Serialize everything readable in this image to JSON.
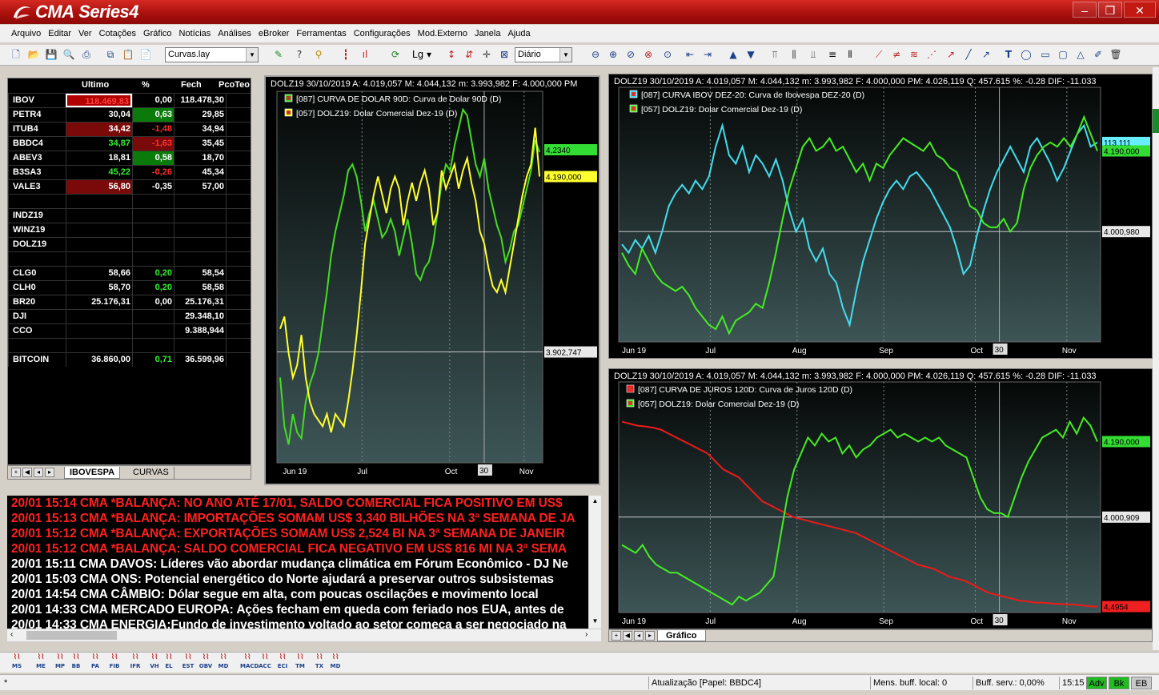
{
  "title_bar": {
    "logo": "CMA",
    "logo_series": "Series4",
    "minimize": "–",
    "restore": "❐",
    "close": "✕"
  },
  "menu": [
    "Arquivo",
    "Editar",
    "Ver",
    "Cotações",
    "Gráfico",
    "Notícias",
    "Análises",
    "eBroker",
    "Ferramentas",
    "Configurações",
    "Mod.Externo",
    "Janela",
    "Ajuda"
  ],
  "toolbar": {
    "layout_select": "Curvas.lay",
    "scale_select": "Lg",
    "period_select": "Diário"
  },
  "quotes": {
    "headers": [
      "Ultimo",
      "%",
      "Fech",
      "PcoTeo"
    ],
    "rows": [
      {
        "sym": "IBOV",
        "last": "118.469,83",
        "pct": "0,00",
        "close": "118.478,30",
        "last_bg": "#b00000",
        "pct_bg": "",
        "last_color": "#ff4040",
        "pct_color": "#ffffff"
      },
      {
        "sym": "PETR4",
        "last": "30,04",
        "pct": "0,63",
        "close": "29,85",
        "last_bg": "",
        "pct_bg": "#0a7a0a",
        "last_color": "#ffffff",
        "pct_color": "#ffffff"
      },
      {
        "sym": "ITUB4",
        "last": "34,42",
        "pct": "-1,48",
        "close": "34,94",
        "last_bg": "#7a0a0a",
        "pct_bg": "",
        "last_color": "#ffffff",
        "pct_color": "#ff3030"
      },
      {
        "sym": "BBDC4",
        "last": "34,87",
        "pct": "-1,63",
        "close": "35,45",
        "last_bg": "",
        "pct_bg": "#7a0a0a",
        "last_color": "#33ee33",
        "pct_color": "#ff3030"
      },
      {
        "sym": "ABEV3",
        "last": "18,81",
        "pct": "0,58",
        "close": "18,70",
        "last_bg": "",
        "pct_bg": "#0a7a0a",
        "last_color": "#ffffff",
        "pct_color": "#ffffff"
      },
      {
        "sym": "B3SA3",
        "last": "45,22",
        "pct": "-0,26",
        "close": "45,34",
        "last_bg": "",
        "pct_bg": "",
        "last_color": "#33ee33",
        "pct_color": "#ff3030"
      },
      {
        "sym": "VALE3",
        "last": "56,80",
        "pct": "-0,35",
        "close": "57,00",
        "last_bg": "#7a0a0a",
        "pct_bg": "",
        "last_color": "#ffffff",
        "pct_color": "#ffffff"
      },
      {
        "sym": "",
        "last": "",
        "pct": "",
        "close": "",
        "last_bg": "",
        "pct_bg": "",
        "last_color": "#ffffff",
        "pct_color": "#ffffff"
      },
      {
        "sym": "INDZ19",
        "last": "",
        "pct": "",
        "close": "",
        "last_bg": "",
        "pct_bg": "",
        "last_color": "#ffffff",
        "pct_color": "#ffffff"
      },
      {
        "sym": "WINZ19",
        "last": "",
        "pct": "",
        "close": "",
        "last_bg": "",
        "pct_bg": "",
        "last_color": "#ffffff",
        "pct_color": "#ffffff"
      },
      {
        "sym": "DOLZ19",
        "last": "",
        "pct": "",
        "close": "",
        "last_bg": "",
        "pct_bg": "",
        "last_color": "#ffffff",
        "pct_color": "#ffffff"
      },
      {
        "sym": "",
        "last": "",
        "pct": "",
        "close": "",
        "last_bg": "",
        "pct_bg": "",
        "last_color": "#ffffff",
        "pct_color": "#ffffff"
      },
      {
        "sym": "CLG0",
        "last": "58,66",
        "pct": "0,20",
        "close": "58,54",
        "last_bg": "",
        "pct_bg": "",
        "last_color": "#ffffff",
        "pct_color": "#33ee33"
      },
      {
        "sym": "CLH0",
        "last": "58,70",
        "pct": "0,20",
        "close": "58,58",
        "last_bg": "",
        "pct_bg": "",
        "last_color": "#ffffff",
        "pct_color": "#33ee33"
      },
      {
        "sym": "BR20",
        "last": "25.176,31",
        "pct": "0,00",
        "close": "25.176,31",
        "last_bg": "",
        "pct_bg": "",
        "last_color": "#ffffff",
        "pct_color": "#ffffff"
      },
      {
        "sym": "DJI",
        "last": "",
        "pct": "",
        "close": "29.348,10",
        "last_bg": "",
        "pct_bg": "",
        "last_color": "#ffffff",
        "pct_color": "#ffffff"
      },
      {
        "sym": "CCO",
        "last": "",
        "pct": "",
        "close": "9.388,944",
        "last_bg": "",
        "pct_bg": "",
        "last_color": "#ffffff",
        "pct_color": "#ffffff"
      },
      {
        "sym": "",
        "last": "",
        "pct": "",
        "close": "",
        "last_bg": "",
        "pct_bg": "",
        "last_color": "#ffffff",
        "pct_color": "#ffffff"
      },
      {
        "sym": "BITCOIN",
        "last": "36.860,00",
        "pct": "0,71",
        "close": "36.599,96",
        "last_bg": "",
        "pct_bg": "",
        "last_color": "#ffffff",
        "pct_color": "#33ee33"
      }
    ],
    "tabs": [
      "IBOVESPA",
      "CURVAS"
    ]
  },
  "news": [
    {
      "text": "20/01 15:14 CMA *BALANÇA: NO ANO ATÉ 17/01, SALDO COMERCIAL FICA POSITIVO EM US$",
      "color": "#ff2020"
    },
    {
      "text": "20/01 15:13 CMA *BALANÇA: IMPORTAÇÕES SOMAM US$ 3,340 BILHÕES NA 3ª SEMANA DE JA",
      "color": "#ff2020"
    },
    {
      "text": "20/01 15:12 CMA *BALANÇA: EXPORTAÇÕES SOMAM US$ 2,524 BI NA 3ª SEMANA DE JANEIR",
      "color": "#ff2020"
    },
    {
      "text": "20/01 15:12 CMA *BALANÇA: SALDO COMERCIAL FICA NEGATIVO EM US$ 816 MI NA 3ª SEMA",
      "color": "#ff2020"
    },
    {
      "text": "20/01 15:11 CMA DAVOS: Líderes vão abordar mudança climática em Fórum Econômico - DJ Ne",
      "color": "#ffffff"
    },
    {
      "text": "20/01 15:03 CMA ONS: Potencial energético do Norte ajudará a preservar outros subsistemas",
      "color": "#ffffff"
    },
    {
      "text": "20/01 14:54 CMA CÂMBIO: Dólar segue em alta, com poucas oscilações e movimento local",
      "color": "#ffffff"
    },
    {
      "text": "20/01 14:33 CMA MERCADO EUROPA: Ações fecham em queda com feriado nos EUA, antes de",
      "color": "#ffffff"
    },
    {
      "text": "20/01 14:33 CMA ENERGIA:Fundo de investimento voltado ao setor começa a ser negociado na",
      "color": "#ffffff"
    }
  ],
  "chart_data": [
    {
      "type": "line",
      "header": "DOLZ19   30/10/2019   A: 4.019,057    M: 4.044,132    m: 3.993,982    F: 4.000,000   PM",
      "x_labels": [
        "Jun 19",
        "Jul",
        "Oct",
        "30",
        "Nov"
      ],
      "yticks": [
        "4.300,000",
        "4.250,000",
        "4.200,000",
        "4.150,000",
        "4.100,000",
        "4.050,000",
        "4.000,000",
        "3.950,000",
        "3.900,000",
        "3.850,000",
        "3.800,000",
        "3.750,000"
      ],
      "ylim": [
        3.72,
        4.33
      ],
      "last_labels": [
        {
          "text": "4,2340",
          "value": 4.234,
          "color": "#33dd33"
        },
        {
          "text": "4.190,000",
          "value": 4.19,
          "color": "#ffff30"
        },
        {
          "text": "3.902,747",
          "value": 3.902,
          "color": "#ffffff"
        }
      ],
      "series": [
        {
          "name": "[087] CURVA DE DOLAR 90D: Curva de Dolar  90D",
          "tag": "(D)",
          "color": "#44dd22",
          "values": [
            3.86,
            3.78,
            3.75,
            3.8,
            3.77,
            3.76,
            3.82,
            3.85,
            3.87,
            3.9,
            3.95,
            4.0,
            4.06,
            4.1,
            4.13,
            4.16,
            4.2,
            4.21,
            4.19,
            4.15,
            4.1,
            4.13,
            4.15,
            4.12,
            4.09,
            4.1,
            4.12,
            4.1,
            4.06,
            4.09,
            4.12,
            4.08,
            4.03,
            4.02,
            4.04,
            4.05,
            4.08,
            4.13,
            4.18,
            4.21,
            4.2,
            4.24,
            4.27,
            4.3,
            4.29,
            4.25,
            4.21,
            4.19,
            4.22,
            4.17,
            4.14,
            4.11,
            4.09,
            4.05,
            4.07,
            4.1,
            4.11,
            4.14,
            4.17,
            4.2,
            4.25,
            4.23
          ]
        },
        {
          "name": "[057] DOLZ19: Dolar Comercial Dez-19",
          "tag": "(D)",
          "color": "#ffff30",
          "values": [
            3.94,
            3.96,
            3.9,
            3.86,
            3.88,
            3.93,
            3.86,
            3.82,
            3.8,
            3.79,
            3.78,
            3.8,
            3.77,
            3.8,
            3.79,
            3.78,
            3.82,
            3.87,
            3.93,
            4.0,
            4.08,
            4.12,
            4.16,
            4.19,
            4.16,
            4.13,
            4.17,
            4.19,
            4.17,
            4.11,
            4.15,
            4.18,
            4.15,
            4.18,
            4.2,
            4.17,
            4.11,
            4.13,
            4.2,
            4.17,
            4.19,
            4.21,
            4.17,
            4.2,
            4.22,
            4.18,
            4.15,
            4.1,
            4.08,
            4.04,
            4.01,
            4.0,
            4.02,
            4.0,
            4.04,
            4.08,
            4.12,
            4.16,
            4.19,
            4.21,
            4.27,
            4.19
          ]
        }
      ]
    },
    {
      "type": "line",
      "header": "DOLZ19   30/10/2019   A: 4.019,057    M: 4.044,132    m: 3.993,982    F: 4.000,000   PM: 4.026,119   Q: 457.615   %: -0.28  DIF: -11.033",
      "x_labels": [
        "Jun 19",
        "Jul",
        "Aug",
        "Sep",
        "Oct",
        "30",
        "Nov"
      ],
      "yticks": [
        "4.300,000",
        "4.200,000",
        "4.100,000",
        "4.000,000",
        "3.900,000",
        "3.800,000"
      ],
      "ylim": [
        3.74,
        4.34
      ],
      "last_labels": [
        {
          "text": "113.111",
          "value": 4.21,
          "color": "#66eeff"
        },
        {
          "text": "4.190,000",
          "value": 4.19,
          "color": "#33dd33"
        },
        {
          "text": "4.000,980",
          "value": 4.0,
          "color": "#ffffff"
        }
      ],
      "series": [
        {
          "name": "[087] CURVA IBOV DEZ-20: Curva de Ibovespa  DEZ-20",
          "tag": "(D)",
          "color": "#44ddee",
          "values": [
            3.97,
            3.95,
            3.98,
            3.96,
            3.99,
            3.95,
            4.0,
            4.06,
            4.09,
            4.11,
            4.09,
            4.12,
            4.1,
            4.13,
            4.2,
            4.25,
            4.18,
            4.16,
            4.2,
            4.14,
            4.18,
            4.16,
            4.13,
            4.17,
            4.12,
            4.05,
            4.0,
            4.03,
            3.96,
            3.93,
            3.96,
            3.9,
            3.88,
            3.82,
            3.78,
            3.86,
            3.93,
            3.98,
            4.03,
            4.07,
            4.1,
            4.12,
            4.1,
            4.13,
            4.14,
            4.12,
            4.1,
            4.07,
            4.04,
            4.01,
            3.96,
            3.9,
            3.92,
            3.99,
            4.05,
            4.1,
            4.14,
            4.17,
            4.2,
            4.17,
            4.14,
            4.2,
            4.22,
            4.19,
            4.16,
            4.12,
            4.15,
            4.19,
            4.23,
            4.25,
            4.2,
            4.21
          ]
        },
        {
          "name": "[057] DOLZ19: Dolar Comercial Dez-19",
          "tag": "(D)",
          "color": "#44ee22",
          "values": [
            3.95,
            3.92,
            3.9,
            3.96,
            3.93,
            3.9,
            3.88,
            3.87,
            3.86,
            3.87,
            3.85,
            3.82,
            3.8,
            3.78,
            3.77,
            3.8,
            3.76,
            3.79,
            3.8,
            3.81,
            3.83,
            3.82,
            3.88,
            3.95,
            4.03,
            4.1,
            4.15,
            4.2,
            4.22,
            4.19,
            4.2,
            4.22,
            4.19,
            4.2,
            4.17,
            4.14,
            4.16,
            4.12,
            4.16,
            4.15,
            4.18,
            4.2,
            4.22,
            4.21,
            4.2,
            4.19,
            4.21,
            4.18,
            4.17,
            4.15,
            4.14,
            4.1,
            4.06,
            4.05,
            4.02,
            4.01,
            4.01,
            4.03,
            4.0,
            4.02,
            4.1,
            4.15,
            4.18,
            4.2,
            4.21,
            4.2,
            4.22,
            4.2,
            4.23,
            4.27,
            4.23,
            4.19
          ]
        }
      ]
    },
    {
      "type": "line",
      "header": "DOLZ19   30/10/2019   A: 4.019,057    M: 4.044,132    m: 3.993,982    F: 4.000,000   PM: 4.026,119   Q: 457.615   %: -0.28  DIF: -11.033",
      "x_labels": [
        "Jun 19",
        "Jul",
        "Aug",
        "Sep",
        "Oct",
        "30",
        "Nov"
      ],
      "yticks": [
        "4.300,000",
        "4.200,000",
        "4.100,000",
        "4.000,000",
        "3.900,000",
        "3.800,000"
      ],
      "ylim": [
        3.76,
        4.34
      ],
      "last_labels": [
        {
          "text": "4.190,000",
          "value": 4.19,
          "color": "#33dd33"
        },
        {
          "text": "4.000,909",
          "value": 4.0,
          "color": "#ffffff"
        },
        {
          "text": "4,4954",
          "value": 3.775,
          "color": "#ee2020"
        }
      ],
      "series": [
        {
          "name": "[087] CURVA DE JUROS 120D: Curva de Juros  120D",
          "tag": "(D)",
          "color": "#ee1a1a",
          "values": [
            4.24,
            4.235,
            4.23,
            4.228,
            4.225,
            4.22,
            4.21,
            4.2,
            4.19,
            4.18,
            4.17,
            4.16,
            4.14,
            4.12,
            4.11,
            4.1,
            4.08,
            4.06,
            4.04,
            4.03,
            4.02,
            4.01,
            4.0,
            3.995,
            3.99,
            3.985,
            3.98,
            3.975,
            3.97,
            3.965,
            3.96,
            3.95,
            3.94,
            3.93,
            3.92,
            3.91,
            3.9,
            3.89,
            3.88,
            3.875,
            3.87,
            3.86,
            3.85,
            3.845,
            3.84,
            3.83,
            3.82,
            3.81,
            3.805,
            3.8,
            3.795,
            3.79,
            3.788,
            3.785,
            3.785,
            3.783,
            3.782,
            3.781,
            3.78,
            3.778,
            3.776,
            3.775
          ]
        },
        {
          "name": "[057] DOLZ19: Dolar Comercial Dez-19",
          "tag": "(D)",
          "color": "#44ee22",
          "values": [
            3.93,
            3.92,
            3.91,
            3.93,
            3.9,
            3.88,
            3.87,
            3.86,
            3.86,
            3.85,
            3.84,
            3.83,
            3.82,
            3.81,
            3.8,
            3.79,
            3.78,
            3.8,
            3.79,
            3.8,
            3.81,
            3.83,
            3.85,
            3.95,
            4.05,
            4.12,
            4.16,
            4.2,
            4.18,
            4.21,
            4.19,
            4.2,
            4.16,
            4.18,
            4.15,
            4.17,
            4.18,
            4.2,
            4.21,
            4.22,
            4.2,
            4.21,
            4.2,
            4.19,
            4.2,
            4.19,
            4.2,
            4.18,
            4.17,
            4.16,
            4.15,
            4.1,
            4.05,
            4.02,
            4.01,
            4.01,
            4.0,
            4.05,
            4.1,
            4.14,
            4.17,
            4.2,
            4.21,
            4.22,
            4.2,
            4.24,
            4.21,
            4.25,
            4.23,
            4.19
          ]
        }
      ]
    }
  ],
  "chart_tab": "Gráfico",
  "status": {
    "mark": "*",
    "update": "Atualização [Papel: BBDC4]",
    "local_buffer": "Mens. buff. local: 0",
    "server_buffer": "Buff. serv.: 0,00%",
    "time": "15:15",
    "adv": "Adv",
    "bk": "Bk",
    "eb": "EB"
  },
  "bottom_icons": [
    "MS",
    "ME",
    "MP",
    "BB",
    "PA",
    "FIB",
    "IFR",
    "VH",
    "EL",
    "EST",
    "OBV",
    "MD",
    "MACD",
    "ACC",
    "ECI",
    "TM",
    "TX",
    "MD"
  ]
}
